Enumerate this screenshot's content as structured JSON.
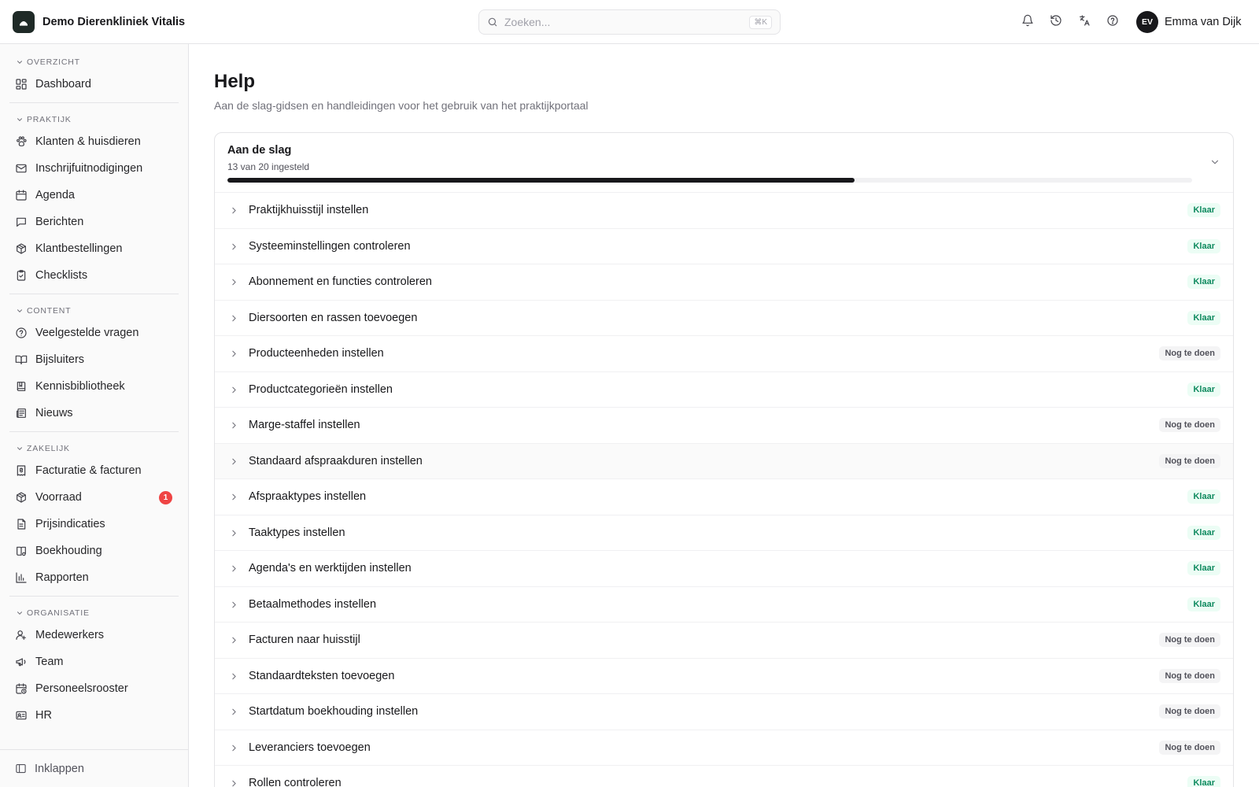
{
  "header": {
    "app_name": "Demo Dierenkliniek Vitalis",
    "search_placeholder": "Zoeken...",
    "search_shortcut": "⌘K",
    "user_initials": "EV",
    "user_name": "Emma van Dijk"
  },
  "sidebar": {
    "groups": [
      {
        "label": "OVERZICHT",
        "items": [
          {
            "label": "Dashboard",
            "icon": "dashboard-icon"
          }
        ]
      },
      {
        "label": "PRAKTIJK",
        "items": [
          {
            "label": "Klanten & huisdieren",
            "icon": "paw-icon"
          },
          {
            "label": "Inschrijfuitnodigingen",
            "icon": "mail-icon"
          },
          {
            "label": "Agenda",
            "icon": "calendar-icon"
          },
          {
            "label": "Berichten",
            "icon": "message-icon"
          },
          {
            "label": "Klantbestellingen",
            "icon": "package-icon"
          },
          {
            "label": "Checklists",
            "icon": "clipboard-check-icon"
          }
        ]
      },
      {
        "label": "CONTENT",
        "items": [
          {
            "label": "Veelgestelde vragen",
            "icon": "help-circle-icon"
          },
          {
            "label": "Bijsluiters",
            "icon": "book-open-icon"
          },
          {
            "label": "Kennisbibliotheek",
            "icon": "book-icon"
          },
          {
            "label": "Nieuws",
            "icon": "newspaper-icon"
          }
        ]
      },
      {
        "label": "ZAKELIJK",
        "items": [
          {
            "label": "Facturatie & facturen",
            "icon": "receipt-icon"
          },
          {
            "label": "Voorraad",
            "icon": "package-icon",
            "badge": "1"
          },
          {
            "label": "Prijsindicaties",
            "icon": "file-text-icon"
          },
          {
            "label": "Boekhouding",
            "icon": "ledger-icon"
          },
          {
            "label": "Rapporten",
            "icon": "bar-chart-icon"
          }
        ]
      },
      {
        "label": "ORGANISATIE",
        "items": [
          {
            "label": "Medewerkers",
            "icon": "user-icon"
          },
          {
            "label": "Team",
            "icon": "megaphone-icon"
          },
          {
            "label": "Personeelsrooster",
            "icon": "calendar-clock-icon"
          },
          {
            "label": "HR",
            "icon": "id-card-icon"
          }
        ]
      }
    ],
    "collapse_label": "Inklappen"
  },
  "main": {
    "title": "Help",
    "subtitle": "Aan de slag-gidsen en handleidingen voor het gebruik van het praktijkportaal",
    "card": {
      "title": "Aan de slag",
      "progress_text": "13 van 20 ingesteld",
      "progress_fraction": 0.65,
      "tasks": [
        {
          "label": "Praktijkhuisstijl instellen",
          "status": "Klaar",
          "done": true
        },
        {
          "label": "Systeeminstellingen controleren",
          "status": "Klaar",
          "done": true
        },
        {
          "label": "Abonnement en functies controleren",
          "status": "Klaar",
          "done": true
        },
        {
          "label": "Diersoorten en rassen toevoegen",
          "status": "Klaar",
          "done": true
        },
        {
          "label": "Producteenheden instellen",
          "status": "Nog te doen",
          "done": false
        },
        {
          "label": "Productcategorieën instellen",
          "status": "Klaar",
          "done": true
        },
        {
          "label": "Marge-staffel instellen",
          "status": "Nog te doen",
          "done": false
        },
        {
          "label": "Standaard afspraakduren instellen",
          "status": "Nog te doen",
          "done": false,
          "highlight": true
        },
        {
          "label": "Afspraaktypes instellen",
          "status": "Klaar",
          "done": true
        },
        {
          "label": "Taaktypes instellen",
          "status": "Klaar",
          "done": true
        },
        {
          "label": "Agenda's en werktijden instellen",
          "status": "Klaar",
          "done": true
        },
        {
          "label": "Betaalmethodes instellen",
          "status": "Klaar",
          "done": true
        },
        {
          "label": "Facturen naar huisstijl",
          "status": "Nog te doen",
          "done": false
        },
        {
          "label": "Standaardteksten toevoegen",
          "status": "Nog te doen",
          "done": false
        },
        {
          "label": "Startdatum boekhouding instellen",
          "status": "Nog te doen",
          "done": false
        },
        {
          "label": "Leveranciers toevoegen",
          "status": "Nog te doen",
          "done": false
        },
        {
          "label": "Rollen controleren",
          "status": "Klaar",
          "done": true
        }
      ]
    }
  },
  "colors": {
    "done_text": "#0f8a5f",
    "done_bg": "#ecfdf5",
    "todo_text": "#52525b",
    "todo_bg": "#f4f4f5",
    "alert": "#ef4444",
    "brand": "#1f2a27"
  }
}
